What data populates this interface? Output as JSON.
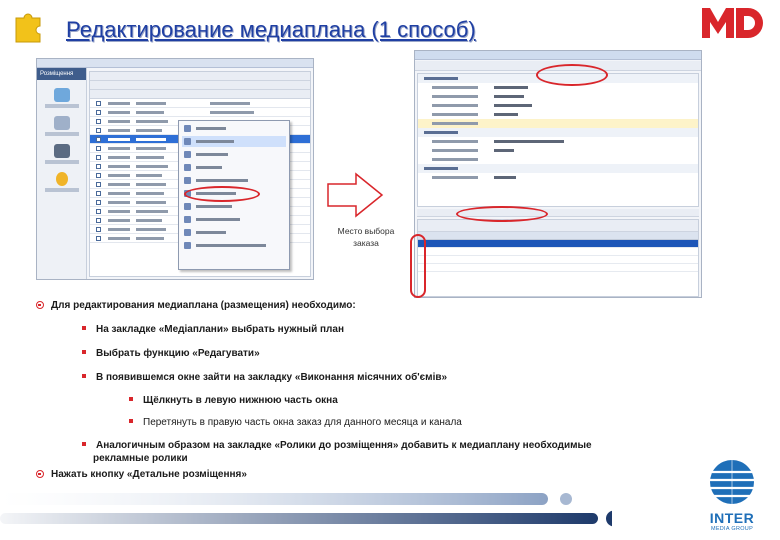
{
  "header": {
    "title": "Редактирование медиаплана (1 способ)",
    "logo_text": "MD"
  },
  "colors": {
    "title": "#1f3fa3",
    "accent_red": "#d9262b",
    "selection_blue": "#2e6fd6",
    "inter_blue": "#1f6fb8"
  },
  "screenshot_left": {
    "sidebar_header": "Розміщення"
  },
  "annotation": {
    "caption_line1": "Место выбора",
    "caption_line2": "заказа"
  },
  "bullets": [
    {
      "level": 1,
      "text": "Для редактирования медиаплана (размещения) необходимо:"
    },
    {
      "level": 2,
      "text": "На закладке «Медіаплани» выбрать нужный план"
    },
    {
      "level": 2,
      "text": "Выбрать функцию «Редагувати»"
    },
    {
      "level": 2,
      "text": "В появившемся окне зайти на закладку «Виконання місячних об'ємів»"
    },
    {
      "level": 3,
      "text": "Щёлкнуть в левую нижнюю часть окна"
    },
    {
      "level": 3,
      "text": "Перетянуть в правую часть окна заказ для данного месяца и канала"
    },
    {
      "level": 2,
      "text": "Аналогичным образом на закладке «Ролики до розміщення» добавить к медиаплану необходимые",
      "continuation": "рекламные ролики"
    },
    {
      "level": 1,
      "text": "Нажать кнопку «Детальне розміщення»"
    }
  ],
  "footer": {
    "brand": "INTER",
    "brand_sub": "MEDIA GROUP"
  }
}
